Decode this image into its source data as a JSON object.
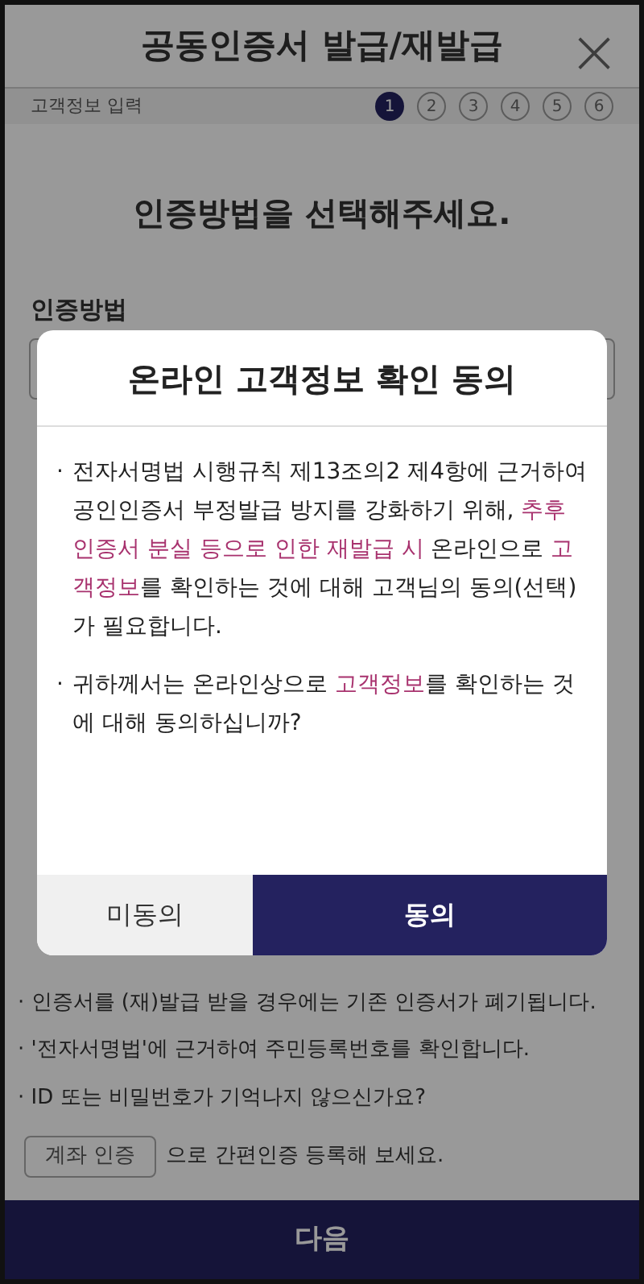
{
  "header": {
    "title": "공동인증서 발급/재발급",
    "close": "×"
  },
  "progress": {
    "label": "고객정보 입력",
    "steps": [
      {
        "label": "1",
        "selected": true
      },
      {
        "label": "2",
        "selected": false
      },
      {
        "label": "3",
        "selected": false
      },
      {
        "label": "4",
        "selected": false
      },
      {
        "label": "5",
        "selected": false
      },
      {
        "label": "6",
        "selected": false
      }
    ]
  },
  "heading": "인증방법을 선택해주세요.",
  "method_label": "인증방법",
  "notes": [
    {
      "bullet": "·",
      "text": "인증서를 (재)발급 받을 경우에는 기존 인증서가 폐기됩니다."
    },
    {
      "bullet": "·",
      "text": "'전자서명법'에 근거하여 주민등록번호를 확인합니다."
    },
    {
      "bullet": "·",
      "text": "ID 또는 비밀번호가 기억나지 않으신가요?"
    }
  ],
  "account_button": "계좌 인증",
  "account_suffix": "으로 간편인증 등록해 보세요.",
  "next_button": "다음",
  "dialog": {
    "title": "온라인 고객정보 확인 동의",
    "paragraphs": [
      {
        "bullet": "·",
        "segments": [
          {
            "text": "전자서명법 시행규칙 제13조의2 제4항에 근거하여 공인인증서 부정발급 방지를 강화하기 위해, ",
            "highlight": false
          },
          {
            "text": "추후 인증서 분실 등으로 인한 재발급 시",
            "highlight": true
          },
          {
            "text": " 온라인으로 ",
            "highlight": false
          },
          {
            "text": "고객정보",
            "highlight": true
          },
          {
            "text": "를 확인하는 것에 대해 고객님의 동의(선택)가 필요합니다.",
            "highlight": false
          }
        ]
      },
      {
        "bullet": "·",
        "segments": [
          {
            "text": "귀하께서는 온라인상으로 ",
            "highlight": false
          },
          {
            "text": "고객정보",
            "highlight": true
          },
          {
            "text": "를 확인하는 것에 대해 동의하십니까?",
            "highlight": false
          }
        ]
      }
    ],
    "buttons": [
      {
        "label": "미동의",
        "kind": "secondary"
      },
      {
        "label": "동의",
        "kind": "primary"
      }
    ]
  }
}
